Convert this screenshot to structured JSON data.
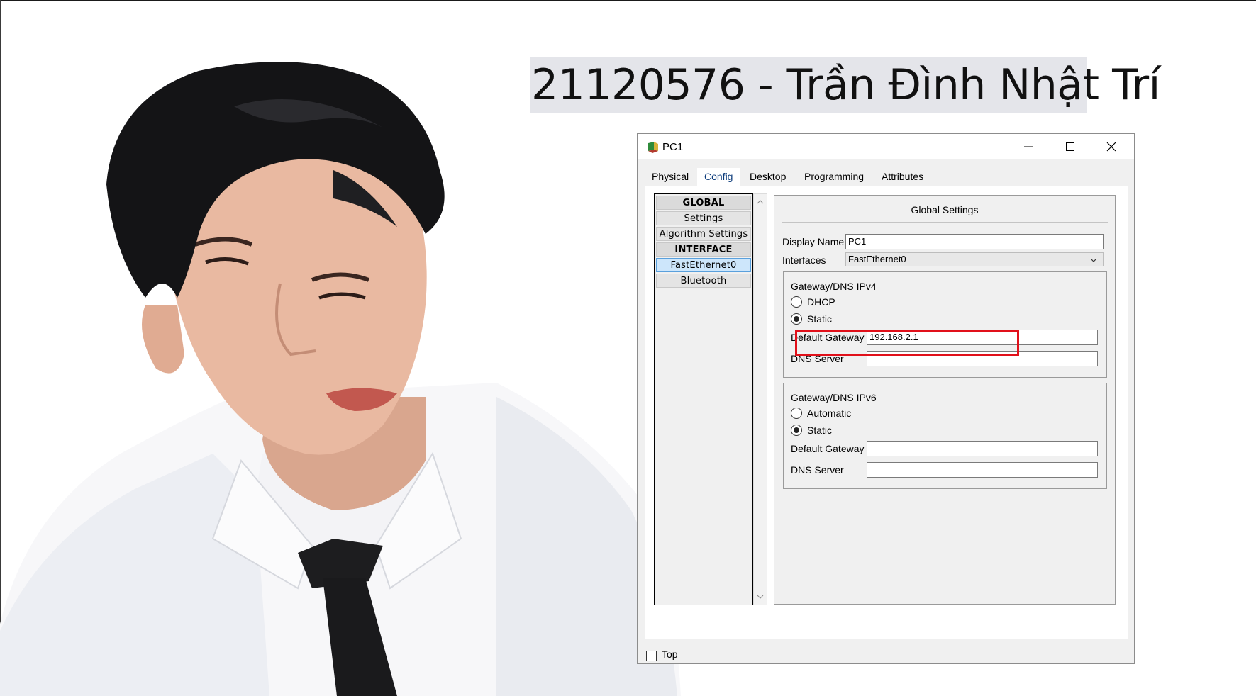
{
  "banner": {
    "text": "21120576 - Trần Đình Nhật Trí"
  },
  "window": {
    "title": "PC1",
    "tabs": [
      "Physical",
      "Config",
      "Desktop",
      "Programming",
      "Attributes"
    ],
    "active_tab": "Config"
  },
  "nav": {
    "items": [
      {
        "label": "GLOBAL",
        "kind": "header"
      },
      {
        "label": "Settings",
        "kind": "item"
      },
      {
        "label": "Algorithm Settings",
        "kind": "item"
      },
      {
        "label": "INTERFACE",
        "kind": "header"
      },
      {
        "label": "FastEthernet0",
        "kind": "selected"
      },
      {
        "label": "Bluetooth",
        "kind": "item"
      }
    ]
  },
  "global": {
    "title": "Global Settings",
    "display_name_label": "Display Name",
    "display_name_value": "PC1",
    "interfaces_label": "Interfaces",
    "interfaces_value": "FastEthernet0"
  },
  "ipv4": {
    "title": "Gateway/DNS IPv4",
    "dhcp_label": "DHCP",
    "static_label": "Static",
    "selected": "Static",
    "gateway_label": "Default Gateway",
    "gateway_value": "192.168.2.1",
    "dns_label": "DNS Server",
    "dns_value": ""
  },
  "ipv6": {
    "title": "Gateway/DNS IPv6",
    "auto_label": "Automatic",
    "static_label": "Static",
    "selected": "Static",
    "gateway_label": "Default Gateway",
    "gateway_value": "",
    "dns_label": "DNS Server",
    "dns_value": ""
  },
  "footer": {
    "top_label": "Top",
    "top_checked": false
  },
  "colors": {
    "highlight": "#e1101a",
    "tab_underline": "#0a2a66",
    "banner_bg": "#e4e5ea"
  }
}
